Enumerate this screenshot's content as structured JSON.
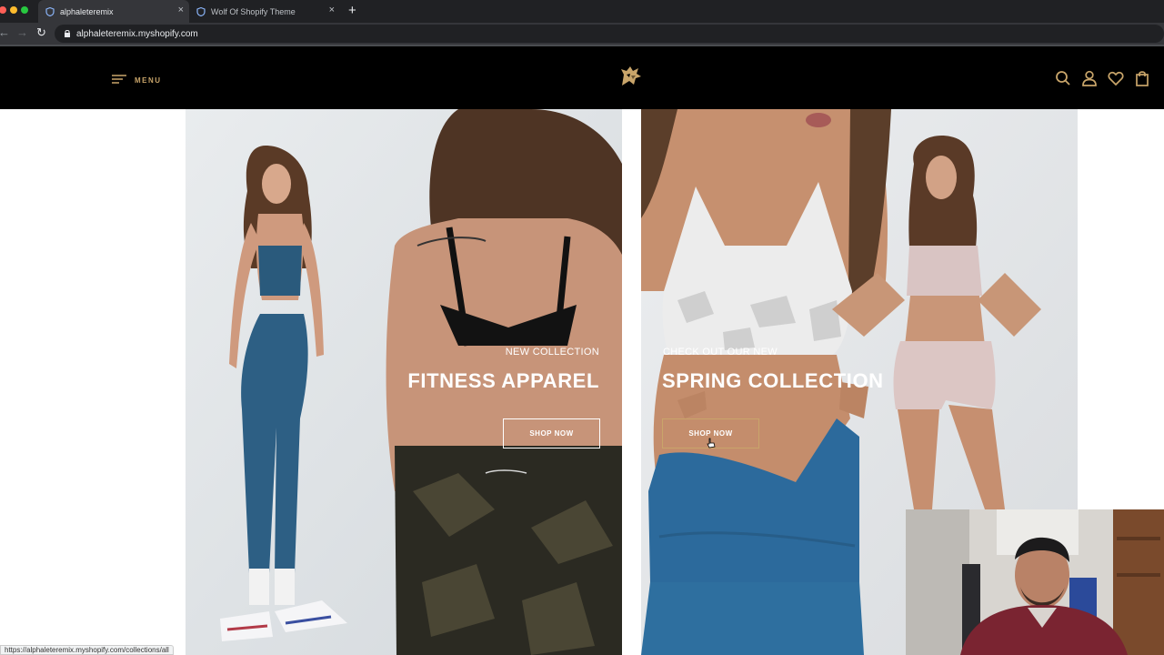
{
  "browser": {
    "tabs": [
      {
        "title": "alphaleteremix"
      },
      {
        "title": "Wolf Of Shopify Theme"
      }
    ],
    "new_tab": "+",
    "url": "alphaleteremix.myshopify.com",
    "status_url": "https://alphaleteremix.myshopify.com/collections/all"
  },
  "header": {
    "menu_label": "MENU",
    "accent_color": "#c9a56a",
    "icons": [
      "search-icon",
      "account-icon",
      "wishlist-icon",
      "cart-icon"
    ]
  },
  "hero": {
    "left": {
      "eyebrow": "NEW COLLECTION",
      "title": "FITNESS APPAREL",
      "button": "SHOP NOW",
      "button_border": "#ffffff"
    },
    "right": {
      "eyebrow": "CHECK OUT OUR NEW",
      "title": "SPRING COLLECTION",
      "button": "SHOP NOW",
      "button_border": "#c9a56a"
    }
  }
}
